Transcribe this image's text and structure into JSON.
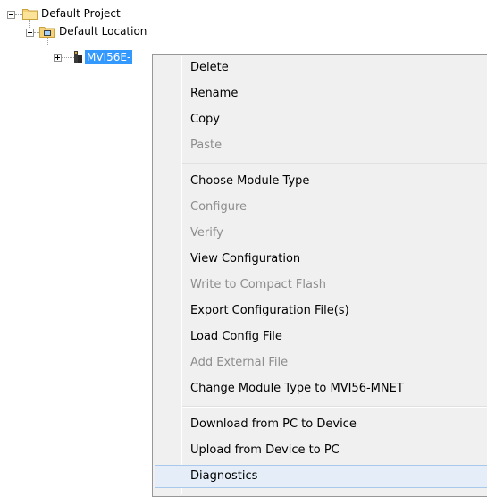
{
  "tree": {
    "root": {
      "label": "Default Project",
      "expanded": true,
      "icon": "folder-icon"
    },
    "location": {
      "label": "Default Location",
      "expanded": true,
      "icon": "folder-open-icon"
    },
    "module": {
      "label": "MVI56E-",
      "expanded": false,
      "selected": true,
      "icon": "module-icon"
    }
  },
  "context_menu": {
    "items": [
      {
        "label": "Delete",
        "enabled": true
      },
      {
        "label": "Rename",
        "enabled": true
      },
      {
        "label": "Copy",
        "enabled": true
      },
      {
        "label": "Paste",
        "enabled": false
      },
      {
        "label": "Choose Module Type",
        "enabled": true
      },
      {
        "label": "Configure",
        "enabled": false
      },
      {
        "label": "Verify",
        "enabled": false
      },
      {
        "label": "View Configuration",
        "enabled": true
      },
      {
        "label": "Write to Compact Flash",
        "enabled": false
      },
      {
        "label": "Export Configuration File(s)",
        "enabled": true
      },
      {
        "label": "Load Config File",
        "enabled": true
      },
      {
        "label": "Add External File",
        "enabled": false
      },
      {
        "label": "Change Module Type to MVI56-MNET",
        "enabled": true
      },
      {
        "label": "Download from PC to Device",
        "enabled": true
      },
      {
        "label": "Upload from Device to PC",
        "enabled": true
      },
      {
        "label": "Diagnostics",
        "enabled": true,
        "highlighted": true
      }
    ]
  },
  "colors": {
    "selection": "#3399ff",
    "menu_background": "#f0f0f0",
    "menu_highlight": "#e5eef8",
    "disabled_text": "#8d8d8d"
  }
}
